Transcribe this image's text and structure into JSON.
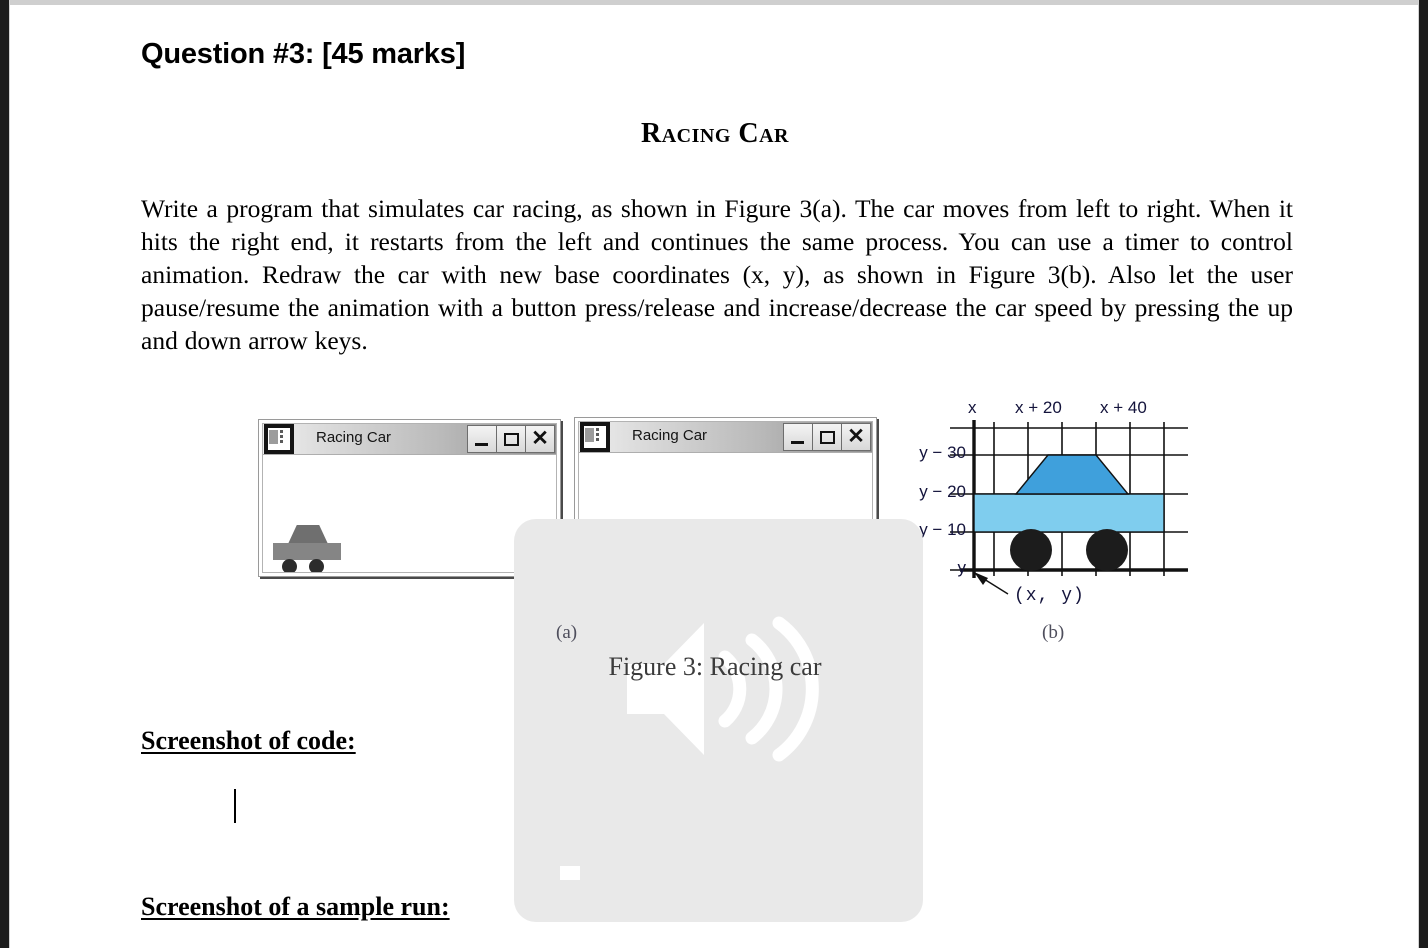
{
  "document": {
    "question_title": "Question #3: [45 marks]",
    "heading": "Racing Car",
    "paragraph": "Write a program that simulates car racing, as shown in Figure 3(a). The car moves from left to right. When it hits the right end, it restarts from the left and continues the same process. You can use a timer to control animation. Redraw the car with new base coordinates (x, y), as shown in Figure 3(b). Also let the user pause/resume the animation with a button press/release and increase/decrease the car speed by pressing the up and down arrow keys.",
    "section_code_heading": "Screenshot of code:",
    "section_run_heading": "Screenshot of a sample run:"
  },
  "figure": {
    "caption": "Figure 3: Racing car",
    "label_a": "(a)",
    "label_b": "(b)",
    "window_a": {
      "title": "Racing Car",
      "icon": "app-window-icon",
      "minimize_label": "_",
      "maximize_label": "□",
      "close_label": "×",
      "car_position": "left"
    },
    "window_b": {
      "title": "Racing Car",
      "icon": "app-window-icon",
      "minimize_label": "_",
      "maximize_label": "□",
      "close_label": "×",
      "car_position": "center"
    },
    "diagram": {
      "x_labels": [
        "x",
        "x + 20",
        "x + 40"
      ],
      "y_labels": [
        "y − 30",
        "y − 20",
        "y − 10",
        "y"
      ],
      "origin_annotation": "(x, y)",
      "colors": {
        "roof": "#3fa0dc",
        "body": "#7fcdee",
        "wheel": "#1c1c1c",
        "grid": "#111111"
      }
    }
  },
  "overlay": {
    "icon": "speaker-volume-icon",
    "panel_color": "#e9e9e9"
  }
}
